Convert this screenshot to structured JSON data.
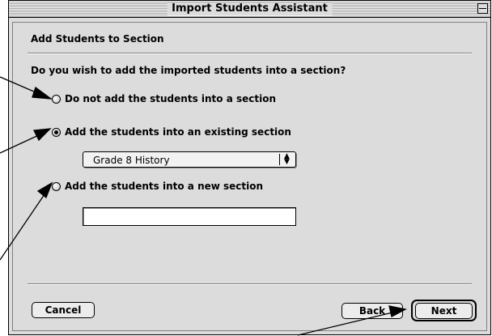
{
  "window": {
    "title": "Import Students Assistant"
  },
  "panel": {
    "section_title": "Add Students to Section",
    "question": "Do you wish to add the imported students into a section?",
    "options": [
      {
        "label": "Do not add the students into a section",
        "selected": false
      },
      {
        "label": "Add the students into an existing section",
        "selected": true
      },
      {
        "label": "Add the students into a new section",
        "selected": false
      }
    ],
    "existing_section": {
      "selected": "Grade 8 History"
    },
    "new_section": {
      "value": ""
    }
  },
  "buttons": {
    "cancel": "Cancel",
    "back": "Back",
    "next": "Next"
  }
}
